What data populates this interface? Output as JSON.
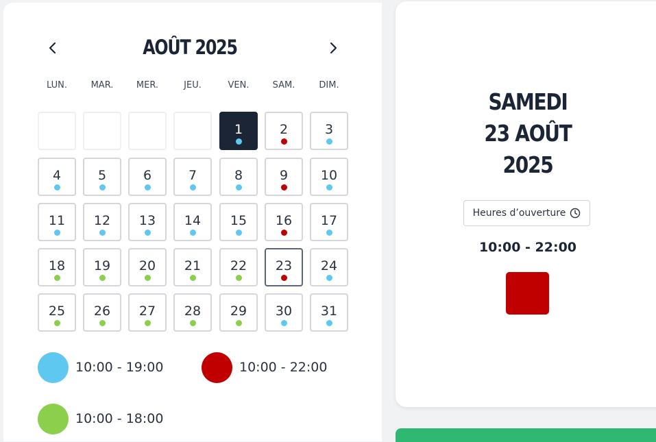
{
  "calendar": {
    "month_title": "AOÛT 2025",
    "prev_icon": "chevron-left-icon",
    "next_icon": "chevron-right-icon",
    "weekdays": [
      "LUN.",
      "MAR.",
      "MER.",
      "JEU.",
      "VEN.",
      "SAM.",
      "DIM."
    ],
    "leading_empty_cells": 4,
    "today": "1",
    "selected": "23",
    "days": [
      {
        "day": "1",
        "schedule": "blue"
      },
      {
        "day": "2",
        "schedule": "red"
      },
      {
        "day": "3",
        "schedule": "blue"
      },
      {
        "day": "4",
        "schedule": "blue"
      },
      {
        "day": "5",
        "schedule": "blue"
      },
      {
        "day": "6",
        "schedule": "blue"
      },
      {
        "day": "7",
        "schedule": "blue"
      },
      {
        "day": "8",
        "schedule": "blue"
      },
      {
        "day": "9",
        "schedule": "red"
      },
      {
        "day": "10",
        "schedule": "blue"
      },
      {
        "day": "11",
        "schedule": "blue"
      },
      {
        "day": "12",
        "schedule": "blue"
      },
      {
        "day": "13",
        "schedule": "blue"
      },
      {
        "day": "14",
        "schedule": "blue"
      },
      {
        "day": "15",
        "schedule": "blue"
      },
      {
        "day": "16",
        "schedule": "red"
      },
      {
        "day": "17",
        "schedule": "blue"
      },
      {
        "day": "18",
        "schedule": "green"
      },
      {
        "day": "19",
        "schedule": "green"
      },
      {
        "day": "20",
        "schedule": "green"
      },
      {
        "day": "21",
        "schedule": "green"
      },
      {
        "day": "22",
        "schedule": "green"
      },
      {
        "day": "23",
        "schedule": "red"
      },
      {
        "day": "24",
        "schedule": "blue"
      },
      {
        "day": "25",
        "schedule": "green"
      },
      {
        "day": "26",
        "schedule": "green"
      },
      {
        "day": "27",
        "schedule": "green"
      },
      {
        "day": "28",
        "schedule": "green"
      },
      {
        "day": "29",
        "schedule": "green"
      },
      {
        "day": "30",
        "schedule": "blue"
      },
      {
        "day": "31",
        "schedule": "blue"
      }
    ]
  },
  "legend": [
    {
      "key": "blue",
      "color": "#5fc8f0",
      "label": "10:00 - 19:00"
    },
    {
      "key": "red",
      "color": "#c00000",
      "label": "10:00 - 22:00"
    },
    {
      "key": "green",
      "color": "#8ccf4d",
      "label": "10:00 - 18:00"
    }
  ],
  "details": {
    "day_line1": "SAMEDI",
    "day_line2": "23 AOÛT",
    "day_line3": "2025",
    "hours_button_label": "Heures d’ouverture",
    "hours_button_icon": "clock-icon",
    "hours_range": "10:00 - 22:00",
    "swatch_color": "#c00000"
  },
  "colors": {
    "dark": "#1c2536",
    "green_bar": "#2eb872"
  }
}
